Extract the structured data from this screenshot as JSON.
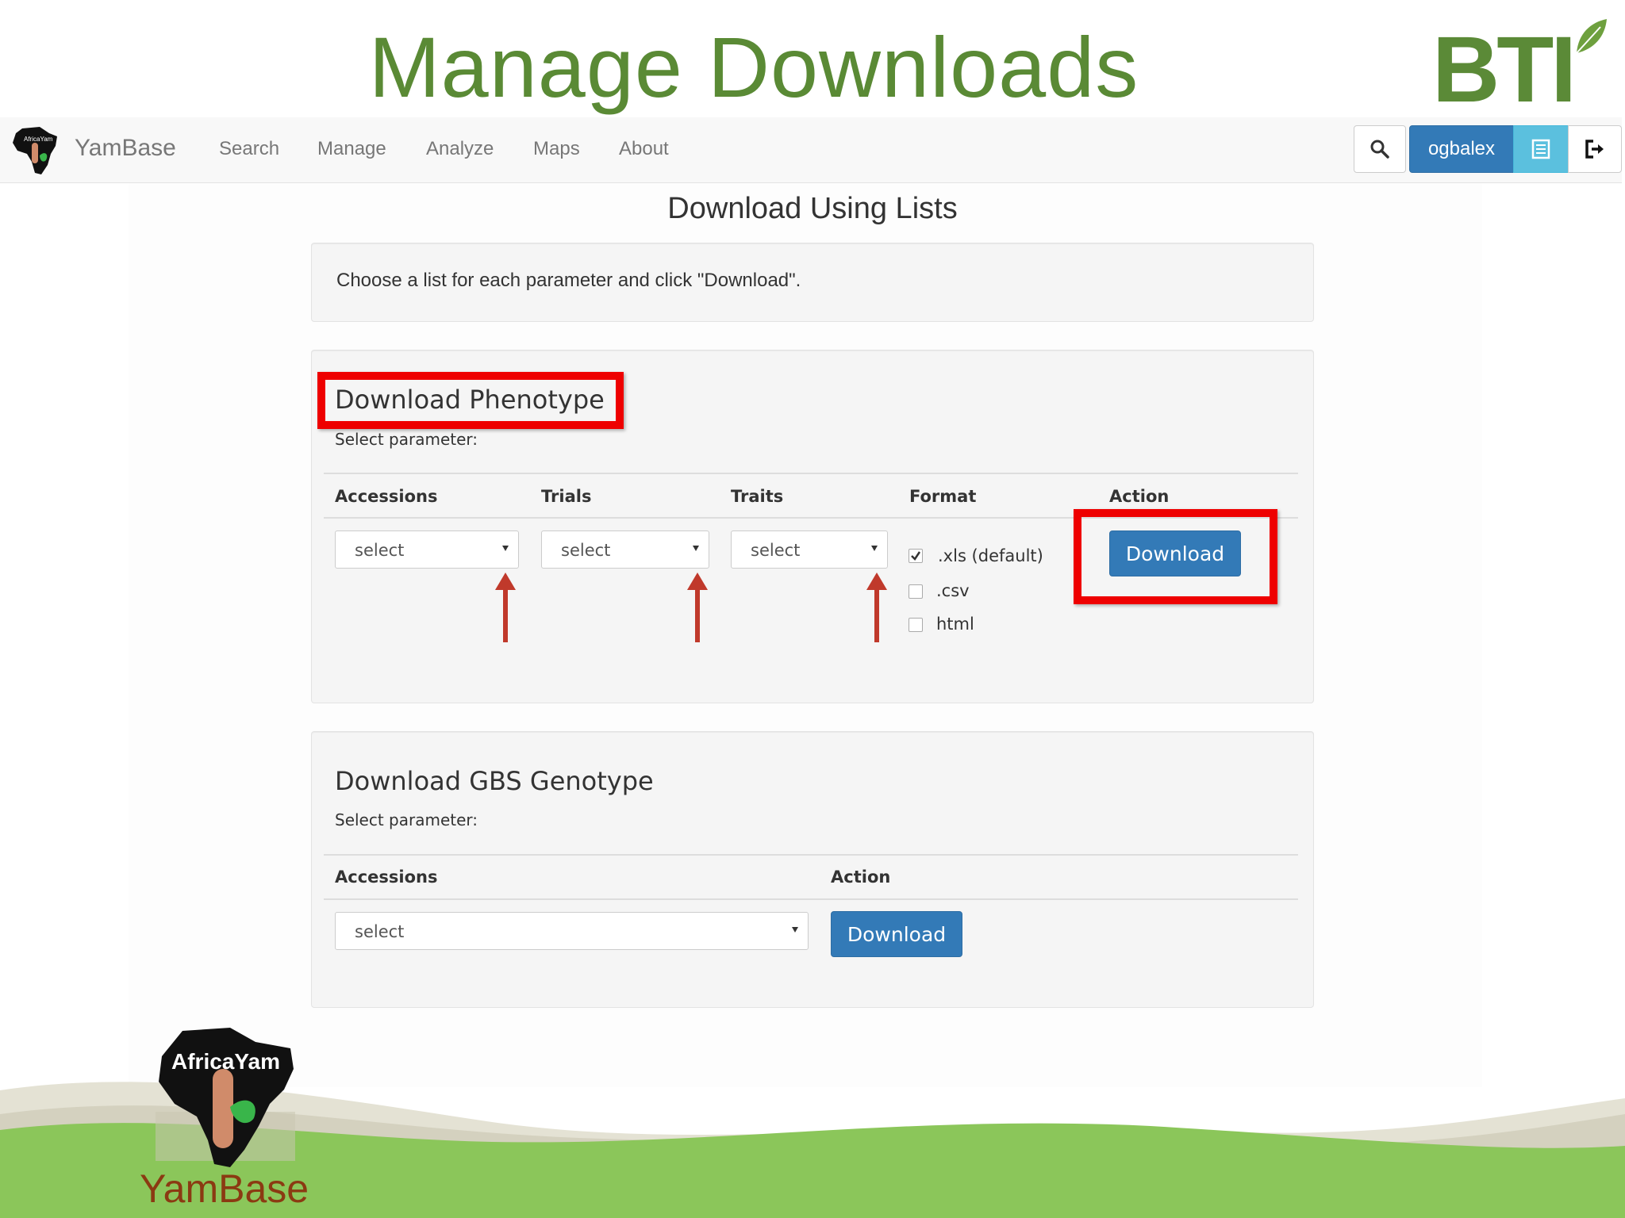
{
  "slide": {
    "title": "Manage Downloads",
    "bti_logo_text": "BTI"
  },
  "navbar": {
    "brand": "YamBase",
    "links": [
      "Search",
      "Manage",
      "Analyze",
      "Maps",
      "About"
    ],
    "user": "ogbalex"
  },
  "page": {
    "heading": "Download Using Lists",
    "intro": "Choose a list for each parameter and click \"Download\"."
  },
  "phenotype": {
    "title": "Download Phenotype",
    "subtitle": "Select parameter:",
    "columns": [
      "Accessions",
      "Trials",
      "Traits",
      "Format",
      "Action"
    ],
    "selects": [
      "select",
      "select",
      "select"
    ],
    "formats": [
      {
        "label": ".xls (default)",
        "checked": true
      },
      {
        "label": ".csv",
        "checked": false
      },
      {
        "label": "html",
        "checked": false
      }
    ],
    "download_label": "Download"
  },
  "genotype": {
    "title": "Download GBS Genotype",
    "subtitle": "Select parameter:",
    "columns": [
      "Accessions",
      "Action"
    ],
    "select": "select",
    "download_label": "Download"
  },
  "footer": {
    "logo_text": "AfricaYam",
    "brand_label": "YamBase"
  },
  "colors": {
    "title_green": "#5a8a35",
    "primary_blue": "#337ab7",
    "info_blue": "#5bc0de",
    "annotation_red": "#ee0000",
    "footer_green": "#8bc65a",
    "footer_brown": "#8b3a12"
  },
  "icons": [
    "search-icon",
    "list-icon",
    "logout-icon",
    "dropdown-caret-icon",
    "annotation-arrow-icon"
  ]
}
